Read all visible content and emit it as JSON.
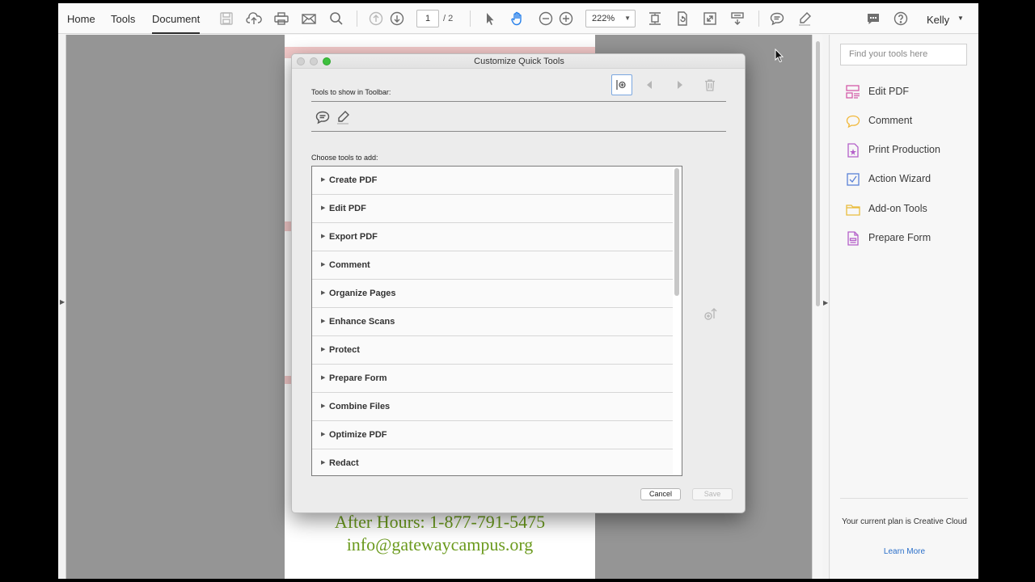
{
  "nav": {
    "tabs": [
      {
        "label": "Home"
      },
      {
        "label": "Tools"
      },
      {
        "label": "Document",
        "active": true
      }
    ]
  },
  "toolbar": {
    "page_current": "1",
    "page_total": "/ 2",
    "zoom": "222%",
    "icons": [
      "save-icon",
      "cloud-upload-icon",
      "print-icon",
      "email-icon",
      "search-icon",
      "page-up-icon",
      "page-down-icon",
      "select-cursor-icon",
      "hand-icon",
      "zoom-out-icon",
      "zoom-in-icon",
      "fit-page-icon",
      "rotate-icon",
      "full-screen-icon",
      "scroll-mode-icon",
      "comment-icon",
      "highlight-icon",
      "chat-icon",
      "help-icon"
    ]
  },
  "user": {
    "name": "Kelly"
  },
  "document": {
    "footer_line1": "After Hours: 1-877-791-5475",
    "footer_line2": "info@gatewaycampus.org",
    "text_color": "#6b9a1d"
  },
  "right_pane": {
    "search_placeholder": "Find your tools here",
    "items": [
      {
        "label": "Edit PDF",
        "icon": "edit-pdf-icon",
        "color": "#d35ba8"
      },
      {
        "label": "Comment",
        "icon": "comment-icon",
        "color": "#f1b83b"
      },
      {
        "label": "Print Production",
        "icon": "print-production-icon",
        "color": "#b460c9"
      },
      {
        "label": "Action Wizard",
        "icon": "action-wizard-icon",
        "color": "#5a82d8"
      },
      {
        "label": "Add-on Tools",
        "icon": "add-on-tools-icon",
        "color": "#e9bd3c"
      },
      {
        "label": "Prepare Form",
        "icon": "prepare-form-icon",
        "color": "#b460c9"
      }
    ],
    "plan_text": "Your current plan is Creative Cloud",
    "learn_more": "Learn More"
  },
  "dialog": {
    "title": "Customize Quick Tools",
    "toolbar_label": "Tools to show in Toolbar:",
    "choose_label": "Choose tools to add:",
    "quick_tools": [
      "comment-icon",
      "highlight-icon"
    ],
    "tools": [
      {
        "label": "Create PDF"
      },
      {
        "label": "Edit PDF"
      },
      {
        "label": "Export PDF"
      },
      {
        "label": "Comment"
      },
      {
        "label": "Organize Pages"
      },
      {
        "label": "Enhance Scans"
      },
      {
        "label": "Protect"
      },
      {
        "label": "Prepare Form"
      },
      {
        "label": "Combine Files"
      },
      {
        "label": "Optimize PDF"
      },
      {
        "label": "Redact"
      }
    ],
    "cancel_label": "Cancel",
    "save_label": "Save"
  }
}
